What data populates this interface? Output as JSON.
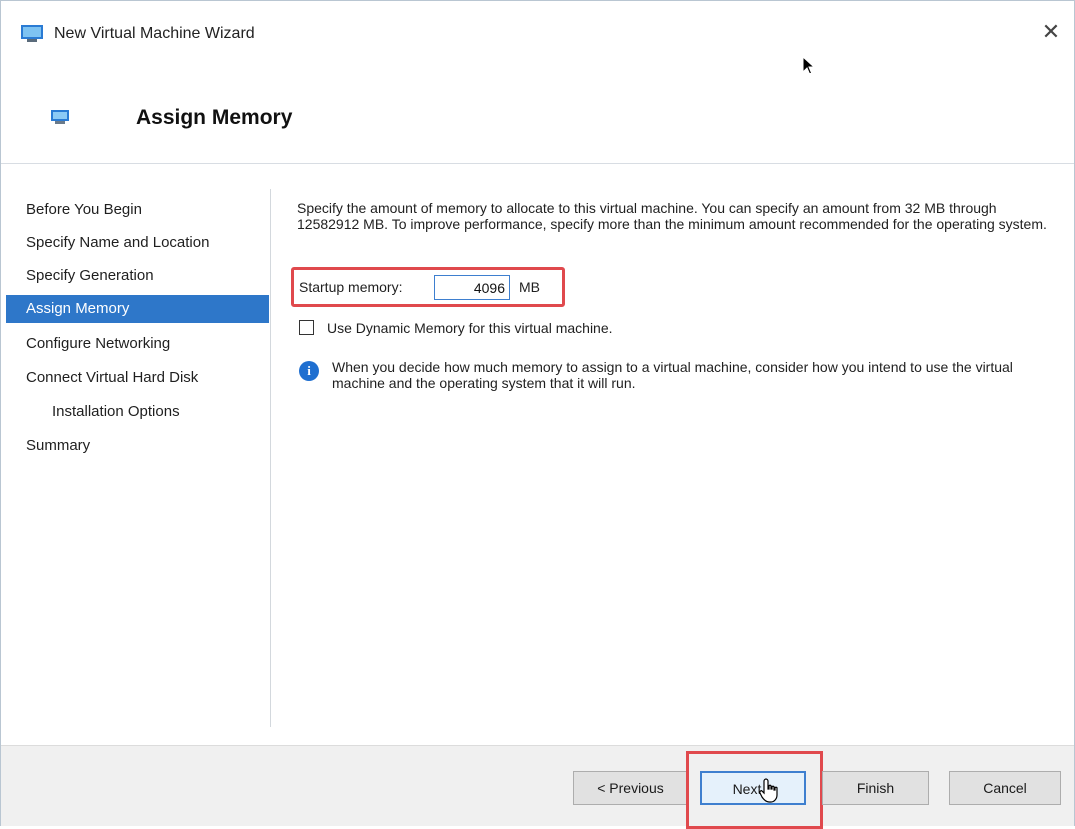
{
  "window": {
    "title": "New Virtual Machine Wizard",
    "close_label": "✕"
  },
  "header": {
    "title": "Assign Memory"
  },
  "sidebar": {
    "items": [
      {
        "label": "Before You Begin"
      },
      {
        "label": "Specify Name and Location"
      },
      {
        "label": "Specify Generation"
      },
      {
        "label": "Assign Memory",
        "selected": true
      },
      {
        "label": "Configure Networking"
      },
      {
        "label": "Connect Virtual Hard Disk"
      },
      {
        "label": "Installation Options"
      },
      {
        "label": "Summary"
      }
    ]
  },
  "main": {
    "description": "Specify the amount of memory to allocate to this virtual machine. You can specify an amount from 32 MB through 12582912 MB. To improve performance, specify more than the minimum amount recommended for the operating system.",
    "startup_memory_label": "Startup memory:",
    "startup_memory_value": "4096",
    "startup_memory_unit": "MB",
    "dynamic_memory_label": "Use Dynamic Memory for this virtual machine.",
    "dynamic_memory_checked": false,
    "info_icon_glyph": "i",
    "info_text": "When you decide how much memory to assign to a virtual machine, consider how you intend to use the virtual machine and the operating system that it will run."
  },
  "footer": {
    "previous_label": "< Previous",
    "next_label": "Next >",
    "finish_label": "Finish",
    "cancel_label": "Cancel"
  },
  "colors": {
    "selection": "#2e77c9",
    "highlight_box": "#e0494d",
    "info_icon": "#1f6fd0",
    "footer_bg": "#f0f0f0"
  }
}
